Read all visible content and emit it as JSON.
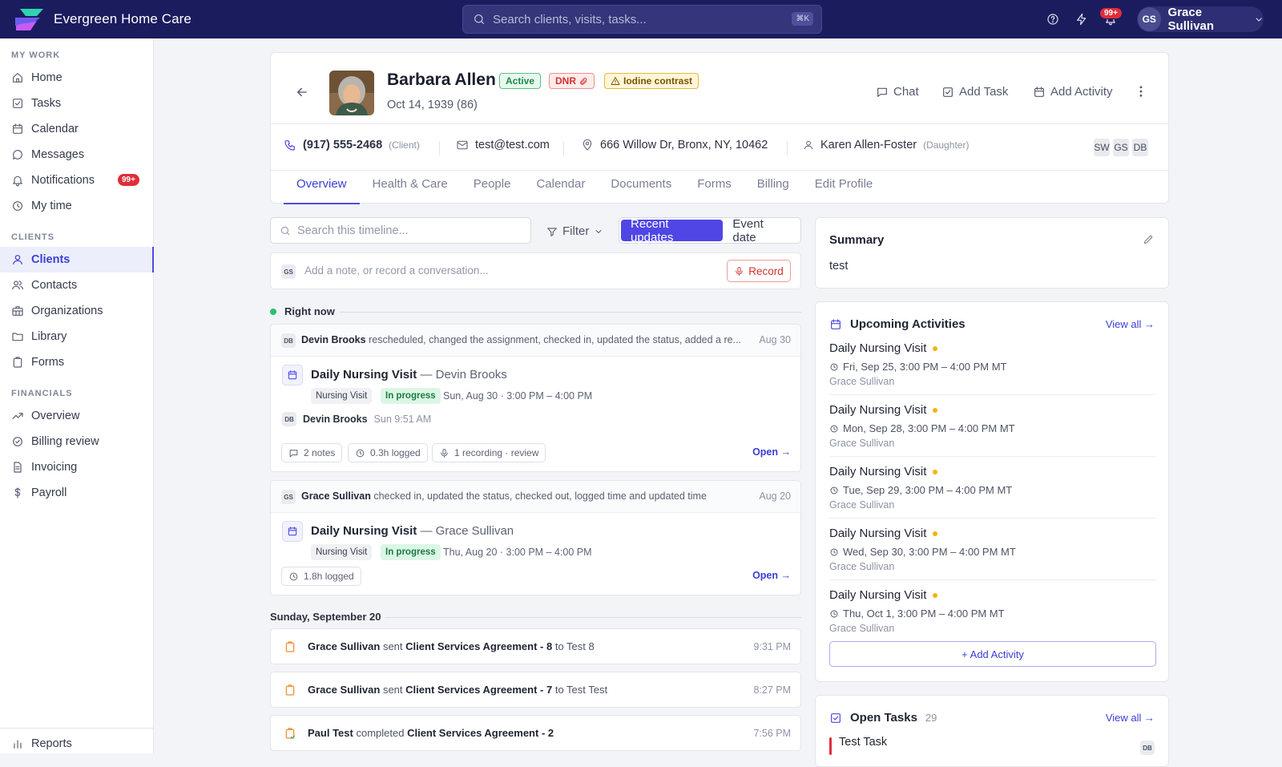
{
  "app": {
    "brand": "Evergreen Home Care",
    "search_placeholder": "Search clients, visits, tasks...",
    "search_shortcut": "⌘K",
    "notification_count": "99+",
    "user_initials": "GS",
    "user_name": "Grace Sullivan",
    "accent_color": "#4f46e5",
    "topbar_color": "#1b1c5e"
  },
  "sidebar": {
    "sections": [
      {
        "label": "MY WORK"
      },
      {
        "label": "CLIENTS"
      },
      {
        "label": "FINANCIALS"
      }
    ],
    "my_work": [
      {
        "label": "Home",
        "icon": "home-icon"
      },
      {
        "label": "Tasks",
        "icon": "tasks-icon"
      },
      {
        "label": "Calendar",
        "icon": "calendar-icon"
      },
      {
        "label": "Messages",
        "icon": "messages-icon"
      },
      {
        "label": "Notifications",
        "icon": "bell-icon",
        "badge": "99+"
      },
      {
        "label": "My time",
        "icon": "clock-icon"
      }
    ],
    "clients": [
      {
        "label": "Clients",
        "icon": "user-icon",
        "active": true
      },
      {
        "label": "Contacts",
        "icon": "contacts-icon"
      },
      {
        "label": "Organizations",
        "icon": "building-icon"
      },
      {
        "label": "Library",
        "icon": "folder-icon"
      },
      {
        "label": "Forms",
        "icon": "clipboard-icon"
      }
    ],
    "financials": [
      {
        "label": "Overview",
        "icon": "trend-icon"
      },
      {
        "label": "Billing review",
        "icon": "check-circle-icon"
      },
      {
        "label": "Invoicing",
        "icon": "document-icon"
      },
      {
        "label": "Payroll",
        "icon": "dollar-icon"
      }
    ],
    "footer": {
      "label": "Reports",
      "icon": "bar-chart-icon"
    }
  },
  "client": {
    "name": "Barbara Allen",
    "status": "Active",
    "dnr": "DNR",
    "allergy": "Iodine contrast",
    "dob": "Oct 14, 1939 (86)",
    "actions": [
      "Chat",
      "Add Task",
      "Add Activity"
    ],
    "phone": "(917) 555-2468",
    "phone_type": "(Client)",
    "email": "test@test.com",
    "address": "666 Willow Dr, Bronx, NY, 10462",
    "contact_name": "Karen Allen-Foster",
    "contact_relation": "(Daughter)",
    "team": [
      "SW",
      "GS",
      "DB"
    ],
    "tabs": [
      "Overview",
      "Health & Care",
      "People",
      "Calendar",
      "Documents",
      "Forms",
      "Billing",
      "Edit Profile"
    ]
  },
  "timeline": {
    "search_placeholder": "Search this timeline...",
    "filter_label": "Filter",
    "sort_options": [
      "Recent updates",
      "Event date"
    ],
    "note_initials": "GS",
    "note_placeholder": "Add a note, or record a conversation...",
    "record_label": "Record",
    "section_now": "Right now",
    "section_day": "Sunday, September 20",
    "cards": [
      {
        "initials": "DB",
        "author": "Devin Brooks",
        "summary": "rescheduled, changed the assignment, checked in, updated the status, added a re...",
        "date": "Aug 30",
        "visit_title": "Daily Nursing Visit",
        "visit_person": "— Devin Brooks",
        "type": "Nursing Visit",
        "status": "In progress",
        "when": "Sun, Aug 30 · 3:00 PM – 4:00 PM",
        "sub_author": "Devin Brooks",
        "sub_time": "Sun 9:51 AM",
        "chips": [
          "2 notes",
          "0.3h logged",
          "1 recording · review"
        ],
        "open": "Open →"
      },
      {
        "initials": "GS",
        "author": "Grace Sullivan",
        "summary": "checked in, updated the status, checked out, logged time and updated time",
        "date": "Aug 20",
        "visit_title": "Daily Nursing Visit",
        "visit_person": "— Grace Sullivan",
        "type": "Nursing Visit",
        "status": "In progress",
        "when": "Thu, Aug 20 · 3:00 PM – 4:00 PM",
        "chips": [
          "1.8h logged"
        ],
        "open": "Open →"
      }
    ],
    "docs": [
      {
        "actor": "Grace Sullivan",
        "verb": "sent",
        "doc": "Client Services Agreement - 8",
        "to": "to Test 8",
        "time": "9:31 PM"
      },
      {
        "actor": "Grace Sullivan",
        "verb": "sent",
        "doc": "Client Services Agreement - 7",
        "to": "to Test Test",
        "time": "8:27 PM"
      },
      {
        "actor": "Paul Test",
        "verb": "completed",
        "doc": "Client Services Agreement - 2",
        "to": "",
        "time": "7:56 PM"
      }
    ]
  },
  "summary": {
    "title": "Summary",
    "text": "test"
  },
  "upcoming": {
    "title": "Upcoming Activities",
    "view_all": "View all →",
    "items": [
      {
        "title": "Daily Nursing Visit",
        "when": "Fri, Sep 25, 3:00 PM – 4:00 PM MT",
        "who": "Grace Sullivan"
      },
      {
        "title": "Daily Nursing Visit",
        "when": "Mon, Sep 28, 3:00 PM – 4:00 PM MT",
        "who": "Grace Sullivan"
      },
      {
        "title": "Daily Nursing Visit",
        "when": "Tue, Sep 29, 3:00 PM – 4:00 PM MT",
        "who": "Grace Sullivan"
      },
      {
        "title": "Daily Nursing Visit",
        "when": "Wed, Sep 30, 3:00 PM – 4:00 PM MT",
        "who": "Grace Sullivan"
      },
      {
        "title": "Daily Nursing Visit",
        "when": "Thu, Oct 1, 3:00 PM – 4:00 PM MT",
        "who": "Grace Sullivan"
      }
    ],
    "add_label": "+ Add Activity"
  },
  "tasks": {
    "title": "Open Tasks",
    "count": "29",
    "view_all": "View all →",
    "first_task": "Test Task",
    "first_assignee": "DB"
  }
}
